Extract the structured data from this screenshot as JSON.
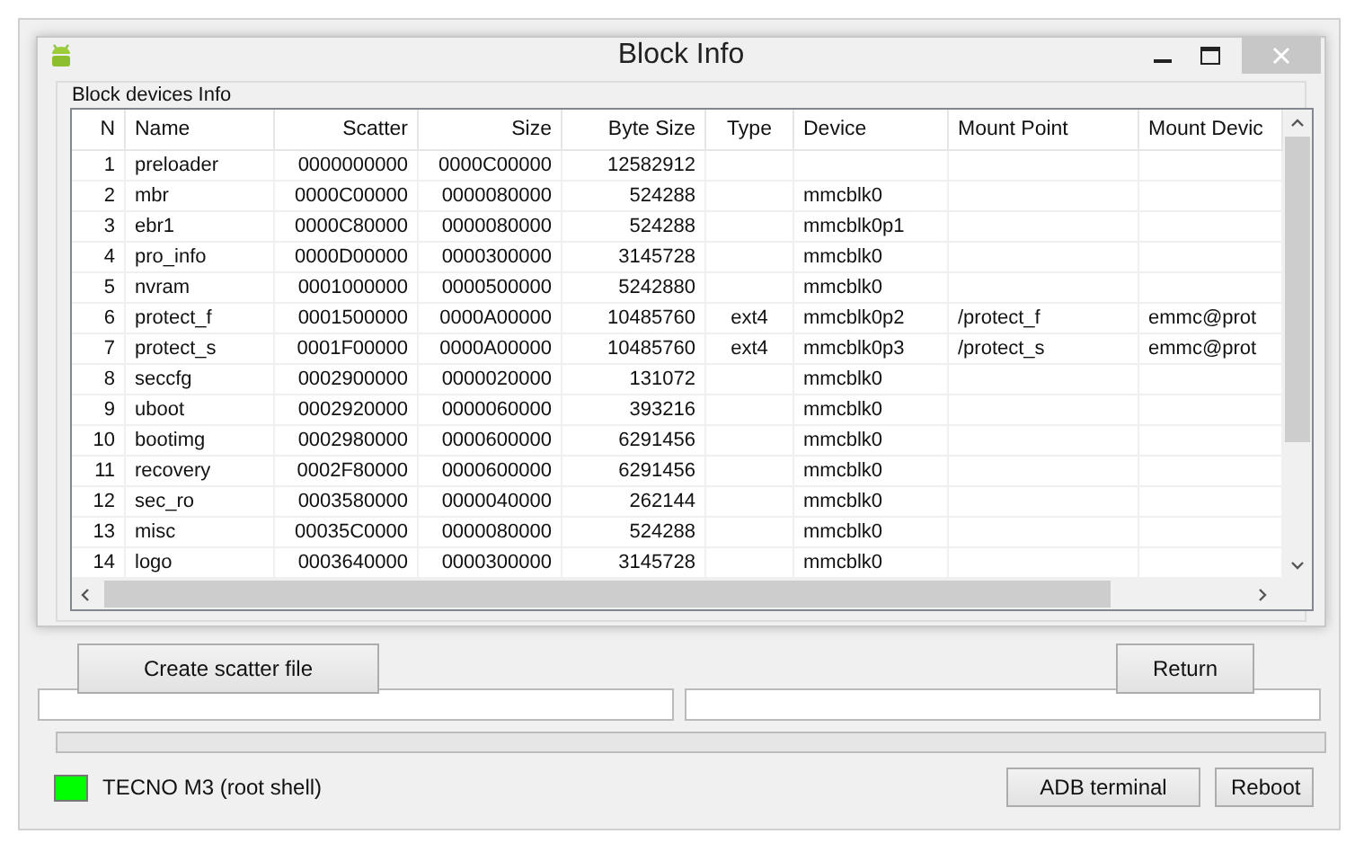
{
  "main_window": {
    "device": {
      "label": "TECNO M3 (root shell)",
      "connected": true
    },
    "progress": {
      "level": 0
    },
    "buttons": [
      "ADB terminal",
      "Reboot"
    ]
  },
  "dialog": {
    "title": "Block Info",
    "group_title": "Block devices Info",
    "table": {
      "columns": [
        "N",
        "Name",
        "Scatter",
        "Size",
        "Byte Size",
        "Type",
        "Device",
        "Mount Point",
        "Mount Devic"
      ],
      "rows": [
        {
          "n": "1",
          "name": "preloader",
          "scatter": "0000000000",
          "size": "0000C00000",
          "byte_size": "12582912"
        },
        {
          "n": "2",
          "name": "mbr",
          "scatter": "0000C00000",
          "size": "0000080000",
          "byte_size": "524288",
          "device": "mmcblk0"
        },
        {
          "n": "3",
          "name": "ebr1",
          "scatter": "0000C80000",
          "size": "0000080000",
          "byte_size": "524288",
          "device": "mmcblk0p1"
        },
        {
          "n": "4",
          "name": "pro_info",
          "scatter": "0000D00000",
          "size": "0000300000",
          "byte_size": "3145728",
          "device": "mmcblk0"
        },
        {
          "n": "5",
          "name": "nvram",
          "scatter": "0001000000",
          "size": "0000500000",
          "byte_size": "5242880",
          "device": "mmcblk0"
        },
        {
          "n": "6",
          "name": "protect_f",
          "scatter": "0001500000",
          "size": "0000A00000",
          "byte_size": "10485760",
          "type": "ext4",
          "device": "mmcblk0p2",
          "mount_point": "/protect_f",
          "mount_device": "emmc@prot"
        },
        {
          "n": "7",
          "name": "protect_s",
          "scatter": "0001F00000",
          "size": "0000A00000",
          "byte_size": "10485760",
          "type": "ext4",
          "device": "mmcblk0p3",
          "mount_point": "/protect_s",
          "mount_device": "emmc@prot"
        },
        {
          "n": "8",
          "name": "seccfg",
          "scatter": "0002900000",
          "size": "0000020000",
          "byte_size": "131072",
          "device": "mmcblk0"
        },
        {
          "n": "9",
          "name": "uboot",
          "scatter": "0002920000",
          "size": "0000060000",
          "byte_size": "393216",
          "device": "mmcblk0"
        },
        {
          "n": "10",
          "name": "bootimg",
          "scatter": "0002980000",
          "size": "0000600000",
          "byte_size": "6291456",
          "device": "mmcblk0"
        },
        {
          "n": "11",
          "name": "recovery",
          "scatter": "0002F80000",
          "size": "0000600000",
          "byte_size": "6291456",
          "device": "mmcblk0"
        },
        {
          "n": "12",
          "name": "sec_ro",
          "scatter": "0003580000",
          "size": "0000040000",
          "byte_size": "262144",
          "device": "mmcblk0"
        },
        {
          "n": "13",
          "name": "misc",
          "scatter": "00035C0000",
          "size": "0000080000",
          "byte_size": "524288",
          "device": "mmcblk0"
        },
        {
          "n": "14",
          "name": "logo",
          "scatter": "0003640000",
          "size": "0000300000",
          "byte_size": "3145728",
          "device": "mmcblk0"
        }
      ]
    },
    "buttons": [
      "Create scatter file",
      "Return"
    ]
  }
}
